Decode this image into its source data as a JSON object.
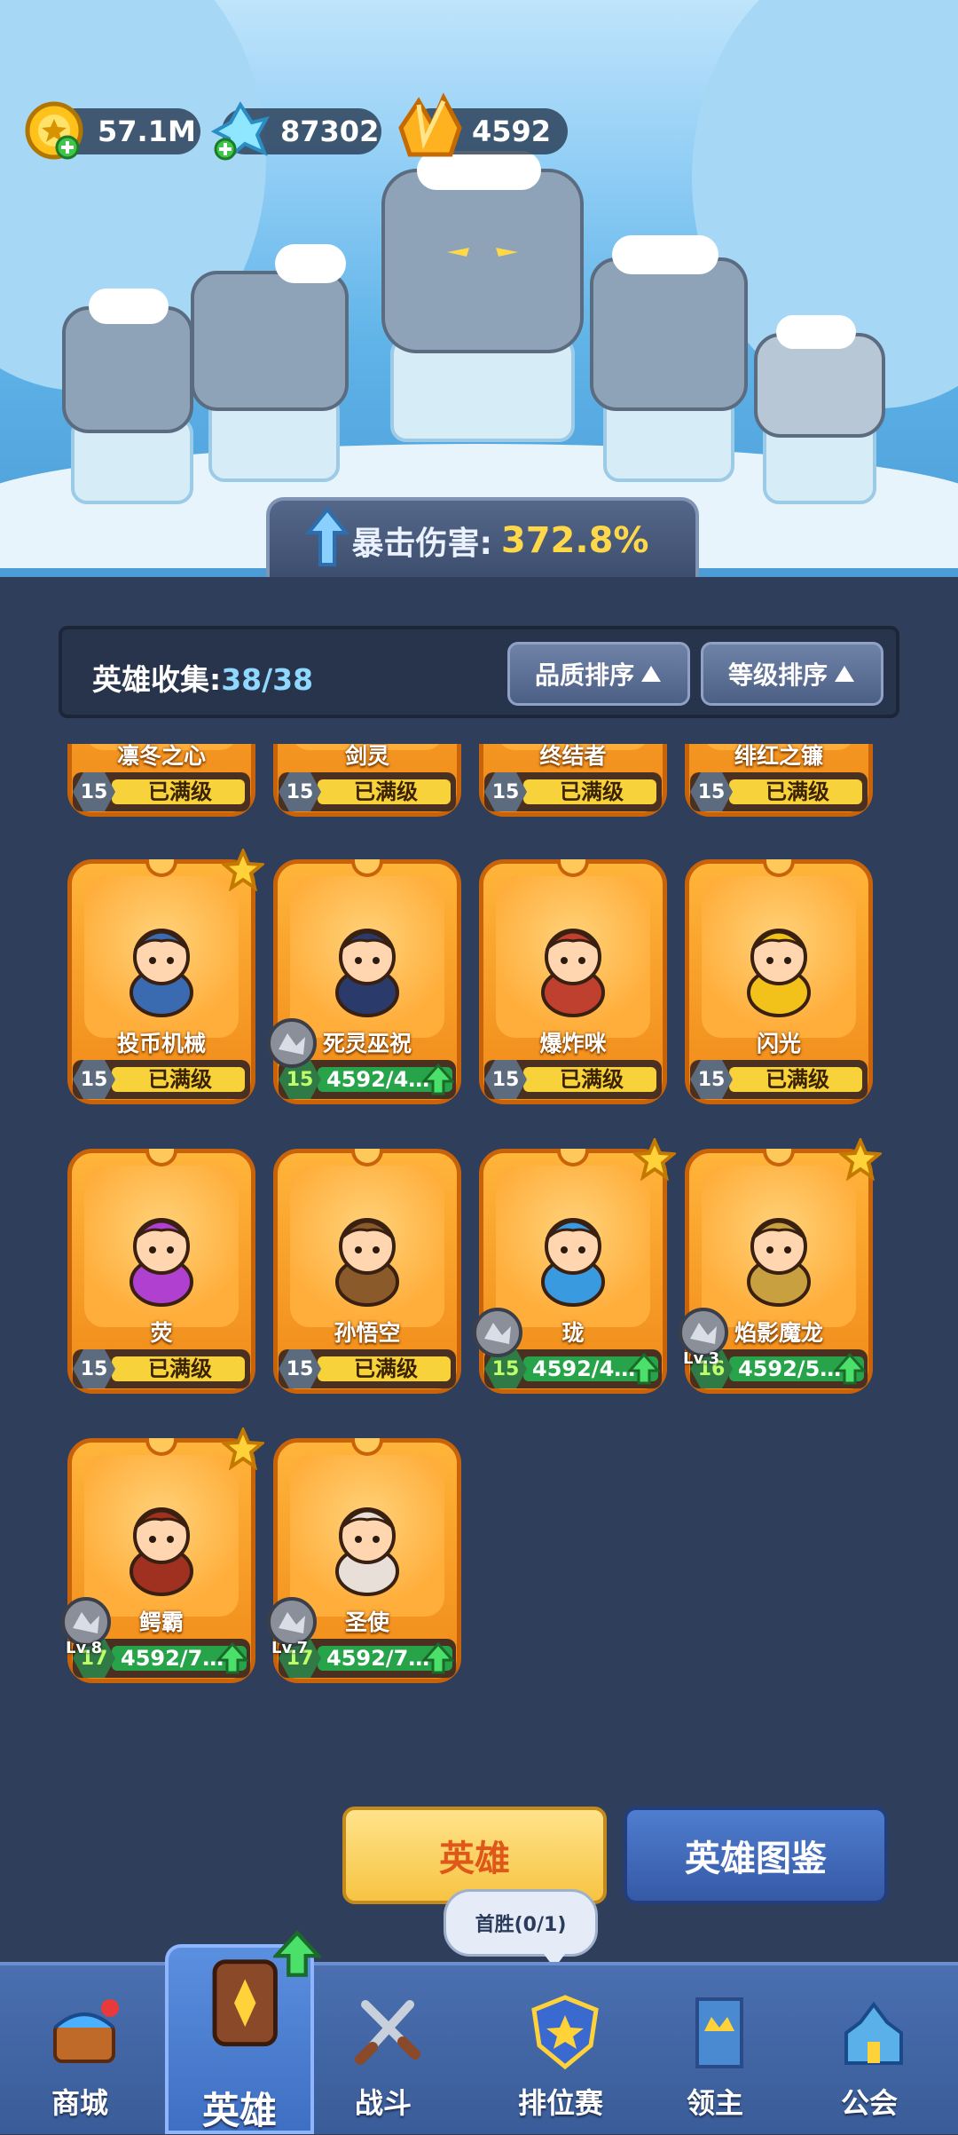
{
  "currencies": [
    {
      "name": "gold-coin-icon",
      "value": "57.1M"
    },
    {
      "name": "crystal-icon",
      "value": "87302"
    },
    {
      "name": "gem-icon",
      "value": "4592"
    }
  ],
  "crit": {
    "label": "暴击伤害:",
    "value": "372.8%"
  },
  "collection": {
    "label": "英雄收集:",
    "count": "38/38"
  },
  "sort": {
    "quality": "品质排序",
    "level": "等级排序"
  },
  "heroes": [
    {
      "name": "凛冬之心",
      "level": "15",
      "status": "已满级",
      "upgradable": false,
      "star": false,
      "badge": false
    },
    {
      "name": "剑灵",
      "level": "15",
      "status": "已满级",
      "upgradable": false,
      "star": false,
      "badge": false
    },
    {
      "name": "终结者",
      "level": "15",
      "status": "已满级",
      "upgradable": false,
      "star": false,
      "badge": false
    },
    {
      "name": "绯红之镰",
      "level": "15",
      "status": "已满级",
      "upgradable": false,
      "star": false,
      "badge": false
    },
    {
      "name": "投币机械",
      "level": "15",
      "status": "已满级",
      "upgradable": false,
      "star": true,
      "badge": false
    },
    {
      "name": "死灵巫祝",
      "level": "15",
      "status": "4592/4…",
      "upgradable": true,
      "star": false,
      "badge": true,
      "badge_lv": ""
    },
    {
      "name": "爆炸咪",
      "level": "15",
      "status": "已满级",
      "upgradable": false,
      "star": false,
      "badge": false
    },
    {
      "name": "闪光",
      "level": "15",
      "status": "已满级",
      "upgradable": false,
      "star": false,
      "badge": false
    },
    {
      "name": "荧",
      "level": "15",
      "status": "已满级",
      "upgradable": false,
      "star": false,
      "badge": false
    },
    {
      "name": "孙悟空",
      "level": "15",
      "status": "已满级",
      "upgradable": false,
      "star": false,
      "badge": false
    },
    {
      "name": "珑",
      "level": "15",
      "status": "4592/4…",
      "upgradable": true,
      "star": true,
      "badge": true,
      "badge_lv": ""
    },
    {
      "name": "焰影魔龙",
      "level": "16",
      "status": "4592/5…",
      "upgradable": true,
      "star": true,
      "badge": true,
      "badge_lv": "Lv.3"
    },
    {
      "name": "鳄霸",
      "level": "17",
      "status": "4592/7…",
      "upgradable": true,
      "star": true,
      "badge": true,
      "badge_lv": "Lv.8"
    },
    {
      "name": "圣使",
      "level": "17",
      "status": "4592/7…",
      "upgradable": true,
      "star": false,
      "badge": true,
      "badge_lv": "Lv.7"
    }
  ],
  "buttons": {
    "hero": "英雄",
    "atlas": "英雄图鉴"
  },
  "tooltip": "首胜(0/1)",
  "nav": [
    {
      "id": "shop",
      "label": "商城",
      "icon": "shop-chest-icon"
    },
    {
      "id": "hero",
      "label": "英雄",
      "icon": "hero-card-icon",
      "active": true
    },
    {
      "id": "battle",
      "label": "战斗",
      "icon": "crossed-swords-icon"
    },
    {
      "id": "ranked",
      "label": "排位赛",
      "icon": "ranked-shield-icon"
    },
    {
      "id": "lord",
      "label": "领主",
      "icon": "crown-banner-icon"
    },
    {
      "id": "guild",
      "label": "公会",
      "icon": "guild-castle-icon"
    }
  ]
}
